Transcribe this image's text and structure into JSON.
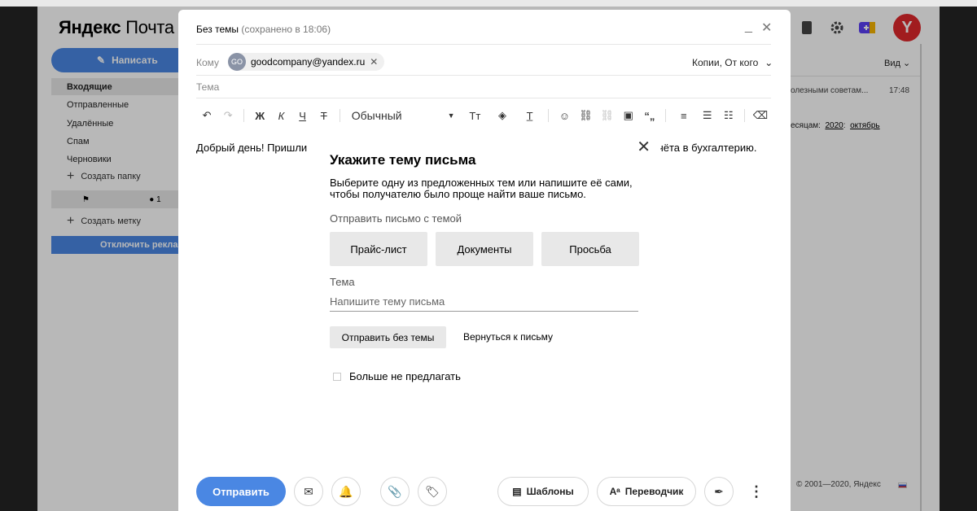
{
  "app": {
    "logo": "Яндекс Почта",
    "logo_brand": "Яндекс",
    "logo_product": "Почта",
    "compose_label": "Написать",
    "avatar_letter": "Y",
    "brand_color": "#4a87e3"
  },
  "sidebar": {
    "folders": [
      {
        "label": "Входящие",
        "active": true
      },
      {
        "label": "Отправленные"
      },
      {
        "label": "Удалённые"
      },
      {
        "label": "Спам"
      },
      {
        "label": "Черновики"
      }
    ],
    "create_folder": "Создать папку",
    "label_counter": "1",
    "create_label": "Создать метку",
    "disable_ads": "Отключить реклам"
  },
  "right_panel": {
    "view_label": "Вид",
    "preview_text": "олезными советам...",
    "preview_time": "17:48",
    "months_prefix": "есяцам:",
    "year_link": "2020",
    "month_link": "октябрь",
    "copyright": "© 2001—2020, Яндекс"
  },
  "compose": {
    "title": "Без темы",
    "saved": "(сохранено в 18:06)",
    "to_label": "Кому",
    "recipient_initials": "GO",
    "recipient": "goodcompany@yandex.ru",
    "copies_label": "Копии, От кого",
    "subject_label": "Тема",
    "font_style": "Обычный",
    "body_start": "Добрый день! Пришли",
    "body_end": "чёта в бухгалтерию.",
    "send_label": "Отправить",
    "templates_label": "Шаблоны",
    "translator_label": "Переводчик"
  },
  "toolbar_icons": [
    "undo-icon",
    "redo-icon",
    "bold-icon",
    "italic-icon",
    "underline-icon",
    "strikethrough-icon",
    "text-size-icon",
    "fill-color-icon",
    "text-color-icon",
    "emoji-icon",
    "link-icon",
    "unlink-icon",
    "image-icon",
    "quote-icon",
    "align-icon",
    "bullet-list-icon",
    "numbered-list-icon",
    "clear-format-icon"
  ],
  "modal": {
    "title": "Укажите тему письма",
    "description": "Выберите одну из предложенных тем или напишите её сами, чтобы получателю было проще найти ваше письмо.",
    "subtitle": "Отправить письмо с темой",
    "topics": [
      "Прайс-лист",
      "Документы",
      "Просьба"
    ],
    "topic_field_label": "Тема",
    "topic_placeholder": "Напишите тему письма",
    "send_without_topic": "Отправить без темы",
    "back_to_letter": "Вернуться к письму",
    "dont_offer": "Больше не предлагать"
  }
}
